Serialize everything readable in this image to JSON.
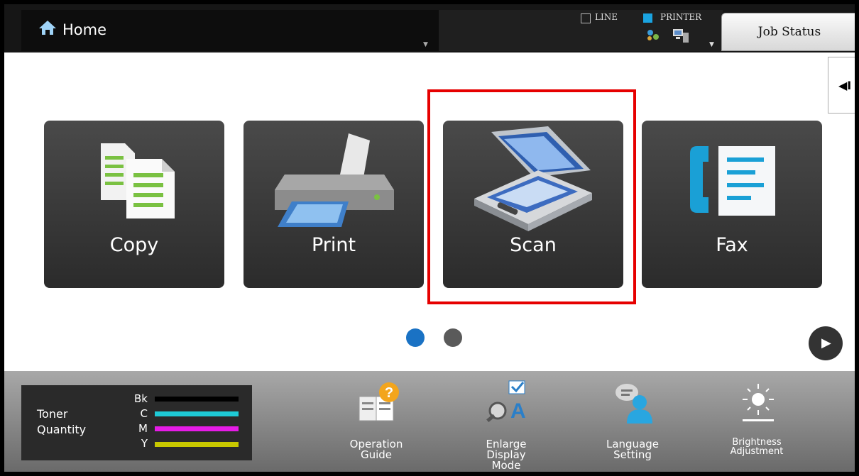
{
  "header": {
    "home_label": "Home",
    "line_label": "LINE",
    "printer_label": "PRINTER",
    "job_status_label": "Job Status"
  },
  "tiles": [
    {
      "label": "Copy",
      "icon": "copy-icon"
    },
    {
      "label": "Print",
      "icon": "printer-icon"
    },
    {
      "label": "Scan",
      "icon": "scanner-icon",
      "highlighted": true
    },
    {
      "label": "Fax",
      "icon": "fax-icon"
    }
  ],
  "pager": {
    "pages": 2,
    "current": 1
  },
  "toner": {
    "title_line1": "Toner",
    "title_line2": "Quantity",
    "levels": [
      {
        "key": "Bk",
        "color": "#000000"
      },
      {
        "key": "C",
        "color": "#1ecad6"
      },
      {
        "key": "M",
        "color": "#e61ce6"
      },
      {
        "key": "Y",
        "color": "#c8c800"
      }
    ]
  },
  "tools": [
    {
      "line1": "Operation",
      "line2": "Guide",
      "line3": "",
      "icon": "operation-guide-icon"
    },
    {
      "line1": "Enlarge",
      "line2": "Display",
      "line3": "Mode",
      "icon": "enlarge-display-icon"
    },
    {
      "line1": "Language",
      "line2": "Setting",
      "line3": "",
      "icon": "language-icon"
    },
    {
      "line1": "Brightness",
      "line2": "Adjustment",
      "line3": "",
      "icon": "brightness-icon"
    }
  ],
  "colors": {
    "highlight": "#e60000",
    "accent": "#1a72c4"
  }
}
